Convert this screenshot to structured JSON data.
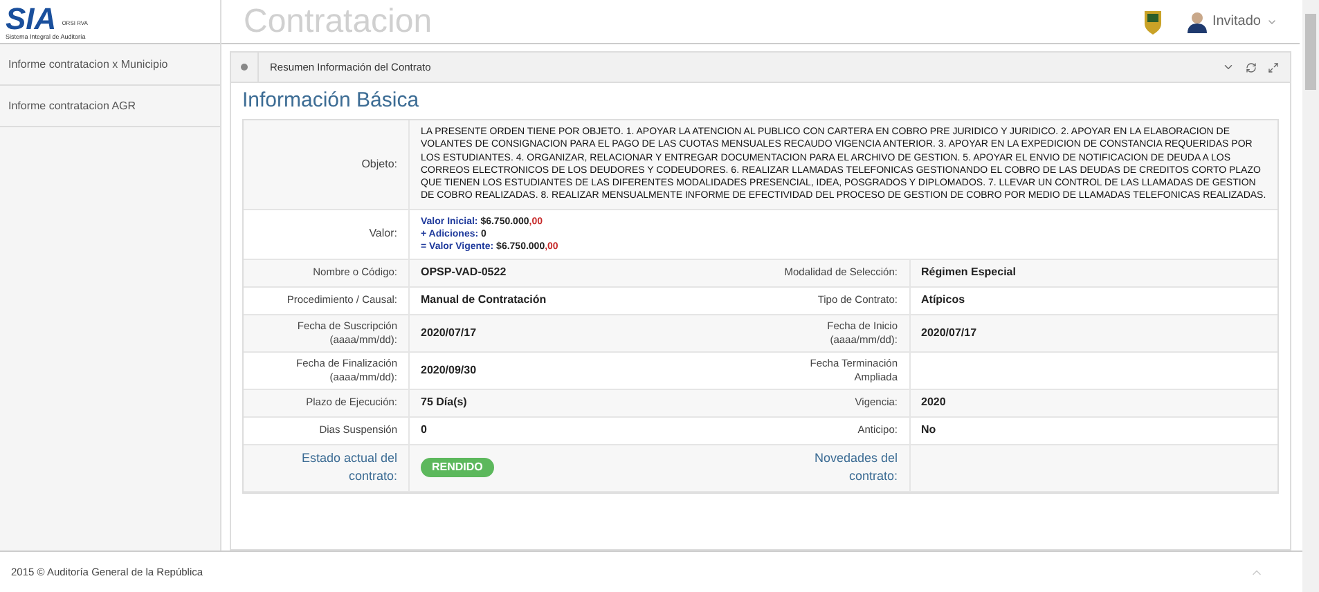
{
  "logo": {
    "letters": "SIA",
    "tag": "ORSI RVA",
    "caption": "Sistema Integral de Auditoría"
  },
  "header": {
    "title": "Contratacion",
    "user": "Invitado"
  },
  "sidebar": {
    "items": [
      {
        "label": "Informe contratacion x Municipio",
        "selected": false
      },
      {
        "label": "Informe contratacion AGR",
        "selected": false
      }
    ]
  },
  "panel": {
    "title": "Resumen Información del Contrato",
    "heading": "Información Básica",
    "objeto": {
      "label": "Objeto:",
      "text": "LA PRESENTE ORDEN TIENE POR OBJETO. 1. APOYAR LA ATENCION AL PUBLICO CON CARTERA EN COBRO PRE JURIDICO Y JURIDICO. 2. APOYAR EN LA ELABORACION DE VOLANTES DE CONSIGNACION PARA EL PAGO DE LAS CUOTAS MENSUALES RECAUDO VIGENCIA ANTERIOR. 3. APOYAR EN LA EXPEDICION DE CONSTANCIA REQUERIDAS POR LOS ESTUDIANTES. 4. ORGANIZAR, RELACIONAR Y ENTREGAR DOCUMENTACION PARA EL ARCHIVO DE GESTION. 5. APOYAR EL ENVIO DE NOTIFICACION DE DEUDA A LOS CORREOS ELECTRONICOS DE LOS DEUDORES Y CODEUDORES. 6. REALIZAR LLAMADAS TELEFONICAS GESTIONANDO EL COBRO DE LAS DEUDAS DE CREDITOS CORTO PLAZO QUE TIENEN LOS ESTUDIANTES DE LAS DIFERENTES MODALIDADES PRESENCIAL, IDEA, POSGRADOS Y DIPLOMADOS. 7. LLEVAR UN CONTROL DE LAS LLAMADAS DE GESTION DE COBRO REALIZADAS. 8. REALIZAR MENSUALMENTE INFORME DE EFECTIVIDAD DEL PROCESO DE GESTION DE COBRO POR MEDIO DE LLAMADAS TELEFONICAS REALIZADAS."
    },
    "valor": {
      "label": "Valor:",
      "lines": [
        {
          "label": "Valor Inicial:",
          "amount": "$6.750.000",
          "cents": ",00"
        },
        {
          "label": "+ Adiciones:",
          "amount": "0"
        },
        {
          "label": "= Valor Vigente:",
          "amount": "$6.750.000",
          "cents": ",00"
        }
      ]
    },
    "rows": [
      {
        "left": {
          "label": "Nombre o Código:",
          "value": "OPSP-VAD-0522"
        },
        "right": {
          "label": "Modalidad de Selección:",
          "value": "Régimen Especial"
        }
      },
      {
        "left": {
          "label": "Procedimiento / Causal:",
          "value": "Manual de Contratación"
        },
        "right": {
          "label": "Tipo de Contrato:",
          "value": "Atípicos"
        }
      },
      {
        "left": {
          "label": "Fecha de Suscripción (aaaa/mm/dd):",
          "value": "2020/07/17"
        },
        "right": {
          "label": "Fecha de Inicio (aaaa/mm/dd):",
          "value": "2020/07/17"
        }
      },
      {
        "left": {
          "label": "Fecha de Finalización (aaaa/mm/dd):",
          "value": "2020/09/30"
        },
        "right": {
          "label": "Fecha Terminación Ampliada"
        }
      },
      {
        "left": {
          "label": "Plazo de Ejecución:",
          "value": "75 Día(s)"
        },
        "right": {
          "label": "Vigencia:",
          "value": "2020"
        }
      },
      {
        "left": {
          "label": "Dias Suspensión",
          "value": "0"
        },
        "right": {
          "label": "Anticipo:",
          "value": "No"
        }
      },
      {
        "kind": "status",
        "left": {
          "label": "Estado actual del contrato:",
          "badge": "RENDIDO"
        },
        "right": {
          "label": "Novedades del contrato:"
        }
      }
    ]
  },
  "footer": "2015 © Auditoría General de la República"
}
